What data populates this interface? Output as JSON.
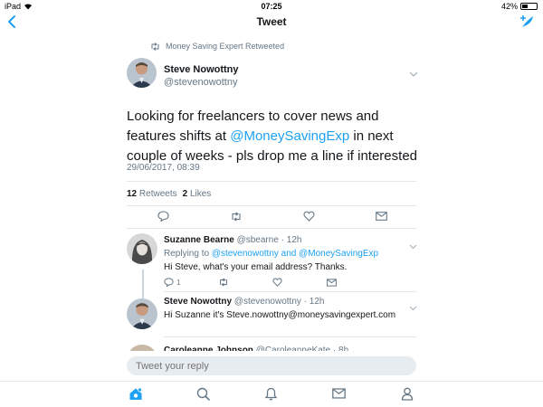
{
  "status_bar": {
    "device": "iPad",
    "time": "07:25",
    "battery": "42%",
    "battery_level": 0.42
  },
  "nav": {
    "title": "Tweet"
  },
  "main_tweet": {
    "retweeted_by": "Money Saving Expert Retweeted",
    "author_name": "Steve Nowottny",
    "author_handle": "@stevenowottny",
    "text_before": "Looking for freelancers to cover news and features shifts at ",
    "mention": "@MoneySavingExp",
    "text_after": " in next couple of weeks - pls drop me a line if interested",
    "timestamp": "29/06/2017, 08:39",
    "retweets_count": "12",
    "retweets_label": "Retweets",
    "likes_count": "2",
    "likes_label": "Likes"
  },
  "replies": [
    {
      "name": "Suzanne Bearne",
      "handle": "@sbearne",
      "time": "· 12h",
      "replying_prefix": "Replying to ",
      "replying_to": "@stevenowottny and @MoneySavingExp",
      "text": "Hi Steve, what's your email address? Thanks.",
      "reply_count": "1"
    },
    {
      "name": "Steve Nowottny",
      "handle": "@stevenowottny",
      "time": "· 12h",
      "text": "Hi Suzanne it's Steve.nowottny@moneysavingexpert.com"
    },
    {
      "name": "Caroleanne Johnson",
      "handle": "@CaroleanneKate",
      "time": "· 8h"
    }
  ],
  "compose": {
    "placeholder": "Tweet your reply"
  },
  "colors": {
    "accent": "#1da1f2",
    "muted": "#657786",
    "divider": "#e1e8ed"
  }
}
